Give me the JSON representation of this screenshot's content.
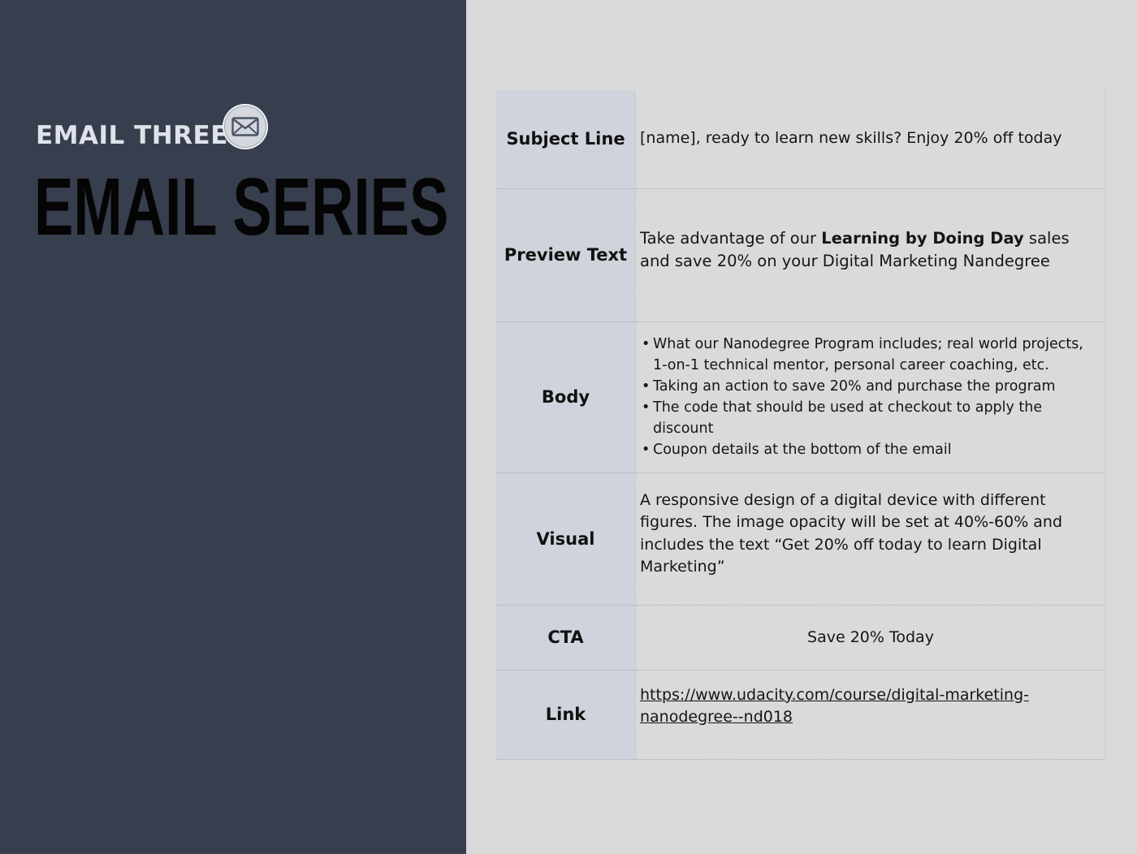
{
  "header": {
    "eyebrow": "EMAIL THREE",
    "icon": "envelope-icon",
    "title": "EMAIL SERIES"
  },
  "spec": {
    "subject": {
      "label": "Subject Line",
      "value": "[name], ready to learn new skills? Enjoy 20% off today"
    },
    "preview": {
      "label": "Preview Text",
      "text_before": "Take advantage of our ",
      "text_bold": "Learning by Doing Day",
      "text_after": " sales and save 20% on your Digital Marketing Nandegree"
    },
    "body": {
      "label": "Body",
      "items": [
        "What our Nanodegree Program includes; real world projects, 1-on-1 technical mentor, personal career coaching, etc.",
        "Taking an action to save 20% and purchase the program",
        "The code that should be used at checkout to apply the discount",
        "Coupon details at the bottom of the email"
      ]
    },
    "visual": {
      "label": "Visual",
      "value": "A responsive design of a digital device with different figures. The image opacity will be set at 40%-60% and includes the text “Get 20% off today to learn Digital Marketing”"
    },
    "cta": {
      "label": "CTA",
      "value": "Save 20% Today"
    },
    "link": {
      "label": "Link",
      "value": "https://www.udacity.com/course/digital-marketing-nanodegree--nd018"
    }
  },
  "colors": {
    "left_panel": "#373e4d",
    "right_panel": "#d9d9d9",
    "label_column": "#cfd3dc",
    "title_text": "#050505",
    "eyebrow_text": "#dfe2ea"
  }
}
